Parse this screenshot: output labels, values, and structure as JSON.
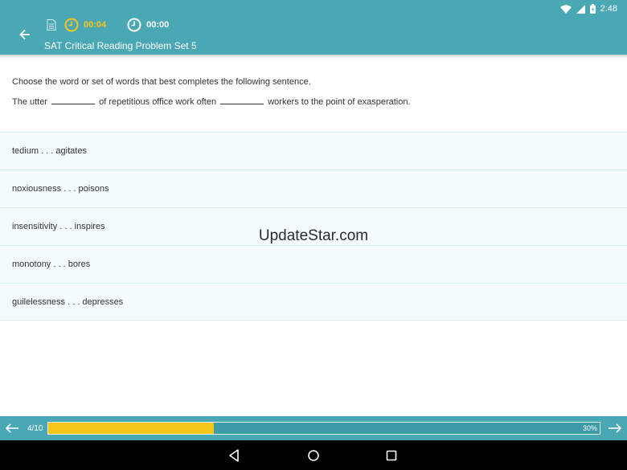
{
  "status_bar": {
    "time": "2:48"
  },
  "toolbar": {
    "elapsed_question_time": "00:04",
    "total_time": "00:00",
    "title": "SAT Critical Reading Problem Set 5"
  },
  "question": {
    "instruction": "Choose the word or set of words that best completes the following sentence.",
    "sentence_part1": "The utter",
    "sentence_part2": "of repetitious office work often",
    "sentence_part3": "workers to the point of exasperation."
  },
  "options": [
    {
      "label": "tedium . . . agitates"
    },
    {
      "label": "noxiousness . . . poisons"
    },
    {
      "label": "insensitivity . . . inspires"
    },
    {
      "label": "monotony . . . bores"
    },
    {
      "label": "guilelessness . . . depresses"
    }
  ],
  "watermark": "UpdateStar.com",
  "progress": {
    "counter": "4/10",
    "percent_label": "30%",
    "fraction": 0.3
  },
  "colors": {
    "primary": "#4aa8b5",
    "accent": "#f5c518",
    "option_background": "#f4fcfd"
  }
}
